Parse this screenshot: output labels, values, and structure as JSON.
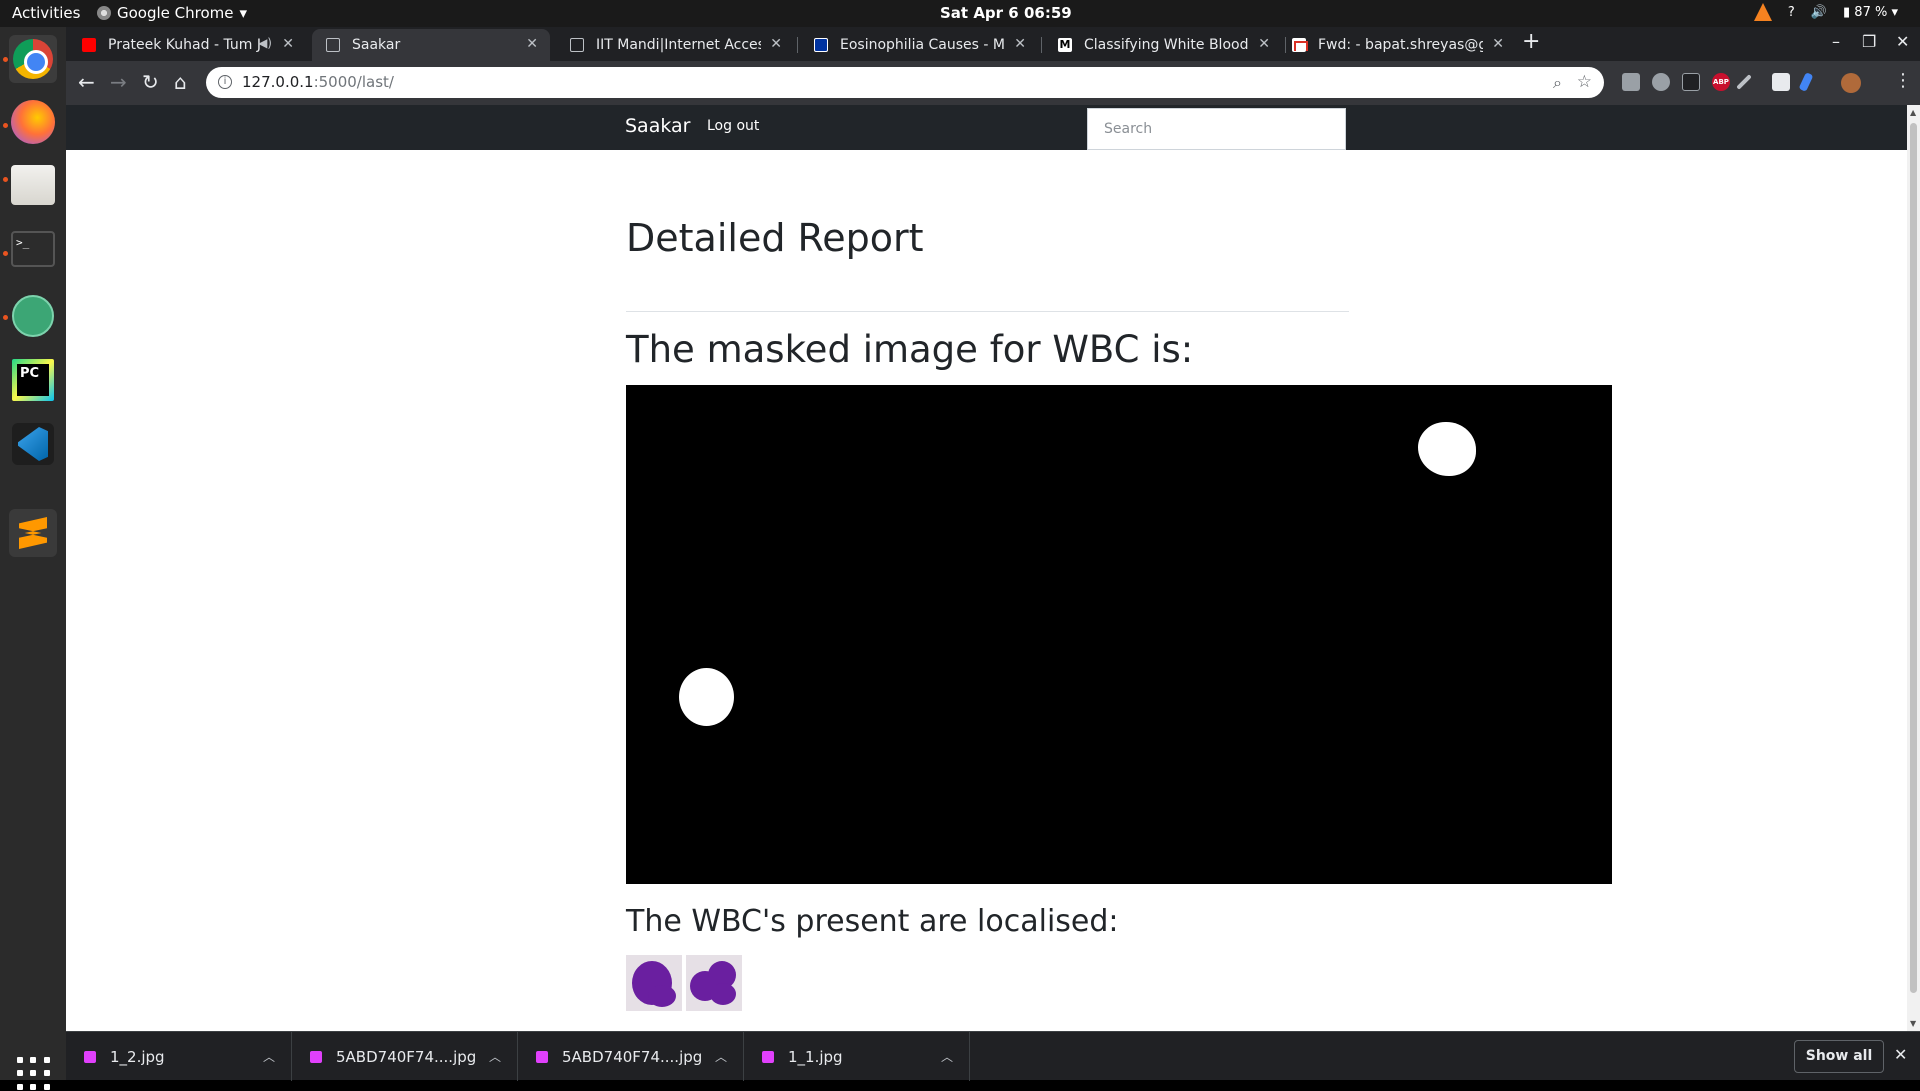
{
  "os": {
    "activities": "Activities",
    "app_menu": "Google Chrome",
    "clock": "Sat Apr 6  06:59",
    "help": "?",
    "battery": "87 %"
  },
  "tabs": [
    {
      "title": "Prateek Kuhad - Tum J",
      "favicon": "youtube-icon"
    },
    {
      "title": "Saakar",
      "favicon": "page-icon"
    },
    {
      "title": "IIT Mandi|Internet Access",
      "favicon": "page-icon"
    },
    {
      "title": "Eosinophilia Causes - May",
      "favicon": "mayo-icon"
    },
    {
      "title": "Classifying White Blood C",
      "favicon": "medium-icon"
    },
    {
      "title": "Fwd: - bapat.shreyas@gm",
      "favicon": "gmail-icon"
    }
  ],
  "omnibox": {
    "host": "127.0.0.1",
    "path": ":5000/last/"
  },
  "site": {
    "brand": "Saakar",
    "logout": "Log out",
    "search_placeholder": "Search"
  },
  "report": {
    "title": "Detailed Report",
    "mask_heading": "The masked image for WBC is:",
    "localised_heading": "The WBC's present are localised:"
  },
  "downloads": [
    {
      "name": "1_2.jpg"
    },
    {
      "name": "5ABD740F74....jpg"
    },
    {
      "name": "5ABD740F74....jpg"
    },
    {
      "name": "1_1.jpg"
    }
  ],
  "shelf": {
    "show_all": "Show all"
  }
}
